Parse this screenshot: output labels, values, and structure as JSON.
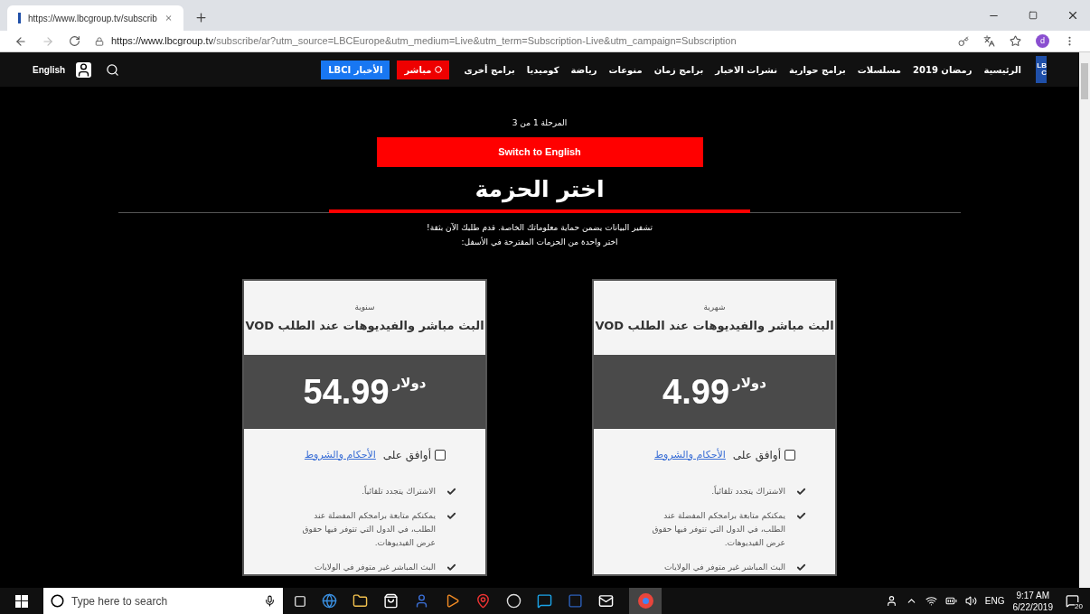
{
  "browser": {
    "tab_title": "https://www.lbcgroup.tv/subscrib",
    "url_host": "https://www.lbcgroup.tv",
    "url_path": "/subscribe/ar?utm_source=LBCEurope&utm_medium=Live&utm_term=Subscription-Live&utm_campaign=Subscription",
    "profile": "d"
  },
  "nav": {
    "logo": "LBC",
    "items": [
      "الرئيسية",
      "رمضان 2019",
      "مسلسلات",
      "برامج حوارية",
      "نشرات الاخبار",
      "برامج زمان",
      "منوعات",
      "رياضة",
      "كوميديا",
      "برامج أخرى"
    ],
    "live": "مباشر",
    "news": "الأخبار LBCI",
    "language": "English"
  },
  "step": "المرحلة 1 من 3",
  "switch_button": "Switch to English",
  "heading": "اختر الحزمة",
  "intro": [
    "تشفير البيانات يضمن حماية معلوماتك الخاصة. قدم طلبك الآن بثقة!",
    "اختر واحدة من الحزمات المقترحة في الأسفل:"
  ],
  "plans": [
    {
      "period": "شهرية",
      "title": "البث مباشر والفيديوهات عند الطلب VOD",
      "price": "4.99",
      "currency": "دولار",
      "agree": "أوافق على",
      "terms_link": "الأحكام والشروط",
      "checked": false,
      "features": [
        "الاشتراك يتجدد تلقائياً.",
        "يمكنكم متابعة برامجكم المفضلة عند الطلب، في الدول التي تتوفر فيها حقوق عرض الفيديوهات.",
        "البث المباشر غير متوفر في الولايات"
      ]
    },
    {
      "period": "سنوية",
      "title": "البث مباشر والفيديوهات عند الطلب VOD",
      "price": "54.99",
      "currency": "دولار",
      "agree": "أوافق على",
      "terms_link": "الأحكام والشروط",
      "checked": false,
      "features": [
        "الاشتراك يتجدد تلقائياً.",
        "يمكنكم متابعة برامجكم المفضلة عند الطلب، في الدول التي تتوفر فيها حقوق عرض الفيديوهات.",
        "البث المباشر غير متوفر في الولايات"
      ]
    }
  ],
  "taskbar": {
    "search_placeholder": "Type here to search",
    "language": "ENG",
    "time": "9:17 AM",
    "date": "6/22/2019",
    "notifications": "20"
  }
}
